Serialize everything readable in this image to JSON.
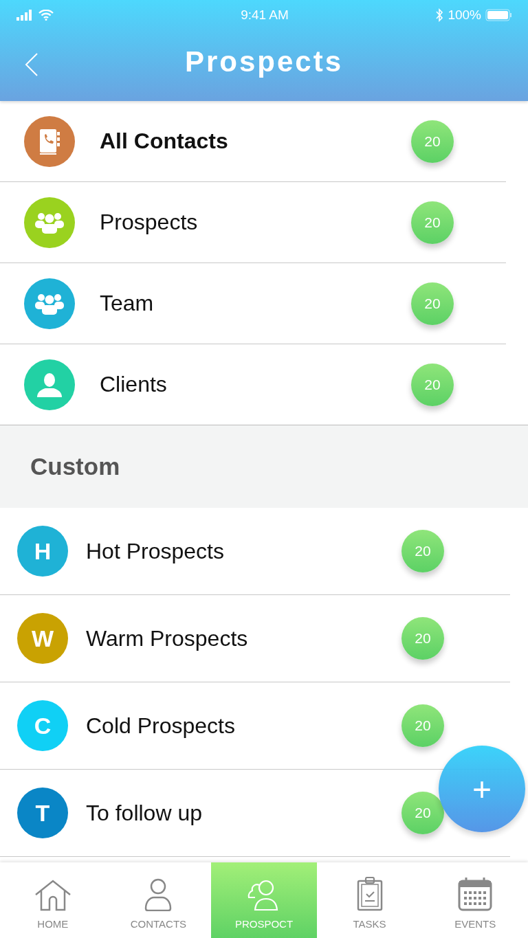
{
  "status_bar": {
    "time": "9:41 AM",
    "battery": "100%"
  },
  "header": {
    "title": "Prospects"
  },
  "groups": [
    {
      "label": "All Contacts",
      "count": "20",
      "kind": "book",
      "color": "#cf7c43",
      "selected": true
    },
    {
      "label": "Prospects",
      "count": "20",
      "kind": "group",
      "color": "#9ad21f",
      "selected": false
    },
    {
      "label": "Team",
      "count": "20",
      "kind": "group",
      "color": "#1fb2d6",
      "selected": false
    },
    {
      "label": "Clients",
      "count": "20",
      "kind": "person",
      "color": "#22d1a4",
      "selected": false
    }
  ],
  "custom": {
    "title": "Custom",
    "lists": [
      {
        "letter": "H",
        "label": "Hot Prospects",
        "count": "20",
        "color": "#1fb2d6"
      },
      {
        "letter": "W",
        "label": "Warm Prospects",
        "count": "20",
        "color": "#c9a202"
      },
      {
        "letter": "C",
        "label": "Cold Prospects",
        "count": "20",
        "color": "#10d0f5"
      },
      {
        "letter": "T",
        "label": "To follow up",
        "count": "20",
        "color": "#0a86c6"
      }
    ]
  },
  "fab": {
    "label": "+"
  },
  "tabs": [
    {
      "label": "HOME",
      "kind": "home",
      "selected": false
    },
    {
      "label": "CONTACTS",
      "kind": "person",
      "selected": false
    },
    {
      "label": "PROSPOCT",
      "kind": "prospect",
      "selected": true
    },
    {
      "label": "TASKS",
      "kind": "clipboard",
      "selected": false
    },
    {
      "label": "EVENTS",
      "kind": "calendar",
      "selected": false
    }
  ]
}
